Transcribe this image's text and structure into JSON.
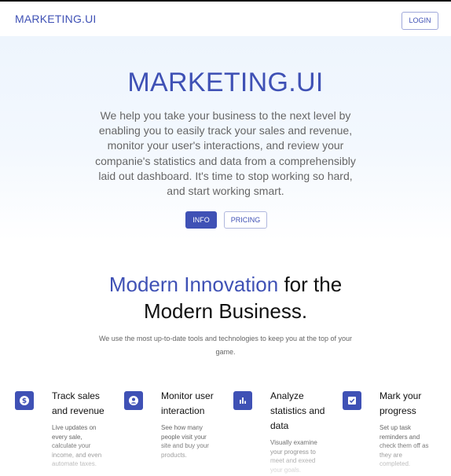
{
  "header": {
    "brand": "MARKETING.UI",
    "login_label": "LOGIN"
  },
  "hero": {
    "title": "MARKETING.UI",
    "description": "We help you take your business to the next level by enabling you to easily track your sales and revenue, monitor your user's interactions, and review your companie's statistics and data from a comprehensibly laid out dashboard. It's time to stop working so hard, and start working smart.",
    "info_label": "INFO",
    "pricing_label": "PRICING"
  },
  "section": {
    "title_accent": "Modern Innovation",
    "title_rest_1": " for the",
    "title_rest_2": "Modern Business.",
    "subtitle": "We use the most up-to-date tools and technologies to keep you at the top of your game."
  },
  "features": [
    {
      "icon": "dollar-icon",
      "title": "Track sales and revenue",
      "description": "Live updates on every sale, calculate your income, and even automate taxes."
    },
    {
      "icon": "user-icon",
      "title": "Monitor user interaction",
      "description": "See how many people visit your site and buy your products."
    },
    {
      "icon": "bar-chart-icon",
      "title": "Analyze statistics and data",
      "description": "Visually examine your progress to meet and exeed your goals."
    },
    {
      "icon": "checklist-icon",
      "title": "Mark your progress",
      "description": "Set up task reminders and check them off as they are completed."
    }
  ],
  "colors": {
    "accent": "#3f51b5",
    "body_text": "#666666"
  }
}
